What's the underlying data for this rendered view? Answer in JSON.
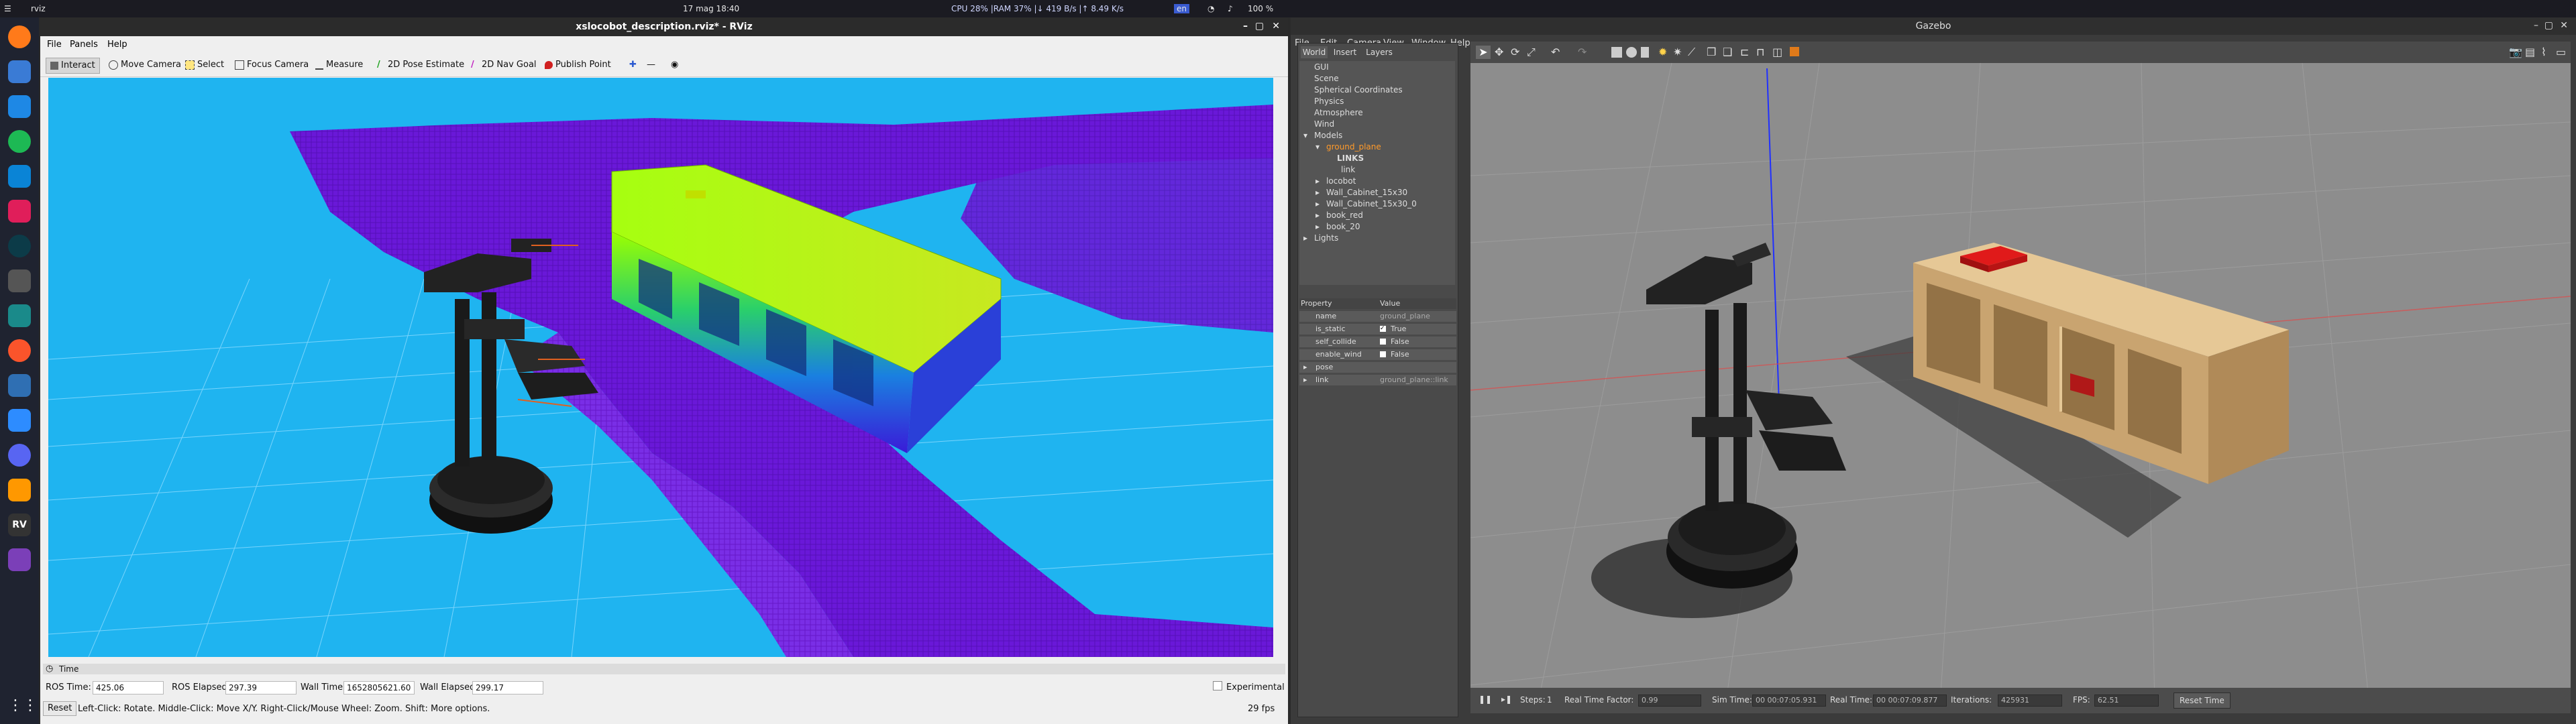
{
  "system_bar": {
    "menu_label": "rviz",
    "datetime": "17 mag 18:40",
    "cpu": "CPU  28% |RAM  37% |↓  419 B/s |↑  8.49 K/s",
    "lang": "en",
    "battery": "100 %"
  },
  "dock": {
    "icons": [
      "firefox-icon",
      "chat-icon",
      "files-icon",
      "spotify-icon",
      "vscode-icon",
      "slack-icon",
      "gitkraken-icon",
      "terminal-icon",
      "code-icon",
      "brave-icon",
      "virtualbox-icon",
      "zoom-icon",
      "discord-icon",
      "sublime-icon",
      "rviz-icon",
      "video-icon",
      "apps-grid-icon"
    ]
  },
  "rviz": {
    "title": "xslocobot_description.rviz* - RViz",
    "menu": [
      "File",
      "Panels",
      "Help"
    ],
    "tools": [
      "Interact",
      "Move Camera",
      "Select",
      "Focus Camera",
      "Measure",
      "2D Pose Estimate",
      "2D Nav Goal",
      "Publish Point"
    ],
    "time_panel_label": "Time",
    "ros_time_label": "ROS Time:",
    "ros_time": "425.06",
    "ros_elapsed_label": "ROS Elapsed:",
    "ros_elapsed": "297.39",
    "wall_time_label": "Wall Time:",
    "wall_time": "1652805621.60",
    "wall_elapsed_label": "Wall Elapsed:",
    "wall_elapsed": "299.17",
    "experimental_label": "Experimental",
    "reset_label": "Reset",
    "hint": "Left-Click: Rotate.  Middle-Click: Move X/Y.  Right-Click/Mouse Wheel: Zoom.  Shift: More options.",
    "fps": "29 fps",
    "colors": {
      "background": "#1fb4f0",
      "floor": "#6a18d8",
      "grid": "#8fdcff"
    }
  },
  "gazebo": {
    "title": "Gazebo",
    "menu": [
      "File",
      "Edit",
      "Camera",
      "View",
      "Window",
      "Help"
    ],
    "tabs": [
      "World",
      "Insert",
      "Layers"
    ],
    "tree": {
      "gui": "GUI",
      "scene": "Scene",
      "spherical": "Spherical Coordinates",
      "physics": "Physics",
      "atmosphere": "Atmosphere",
      "wind": "Wind",
      "models": "Models",
      "ground_plane": "ground_plane",
      "links": "LINKS",
      "link": "link",
      "locobot": "locobot",
      "wall1": "Wall_Cabinet_15x30",
      "wall2": "Wall_Cabinet_15x30_0",
      "book_red": "book_red",
      "book_20": "book_20",
      "lights": "Lights"
    },
    "props": {
      "header_property": "Property",
      "header_value": "Value",
      "rows": [
        {
          "name": "name",
          "value": "ground_plane"
        },
        {
          "name": "is_static",
          "value": "True",
          "checked": true
        },
        {
          "name": "self_collide",
          "value": "False",
          "checked": false
        },
        {
          "name": "enable_wind",
          "value": "False",
          "checked": false
        },
        {
          "name": "pose",
          "value": ""
        },
        {
          "name": "link",
          "value": "ground_plane::link"
        }
      ]
    },
    "bottom": {
      "steps_label": "Steps:",
      "steps": "1",
      "rtf_label": "Real Time Factor:",
      "rtf": "0.99",
      "sim_label": "Sim Time:",
      "sim": "00 00:07:05.931",
      "real_label": "Real Time:",
      "real": "00 00:07:09.877",
      "iter_label": "Iterations:",
      "iter": "425931",
      "fps_label": "FPS:",
      "fps": "62.51",
      "reset_time": "Reset Time"
    },
    "colors": {
      "ground": "#8d8d8d",
      "cabinet": "#d8b886",
      "cabinet_dark": "#a98a5a",
      "book_red": "#d01a1a"
    }
  }
}
